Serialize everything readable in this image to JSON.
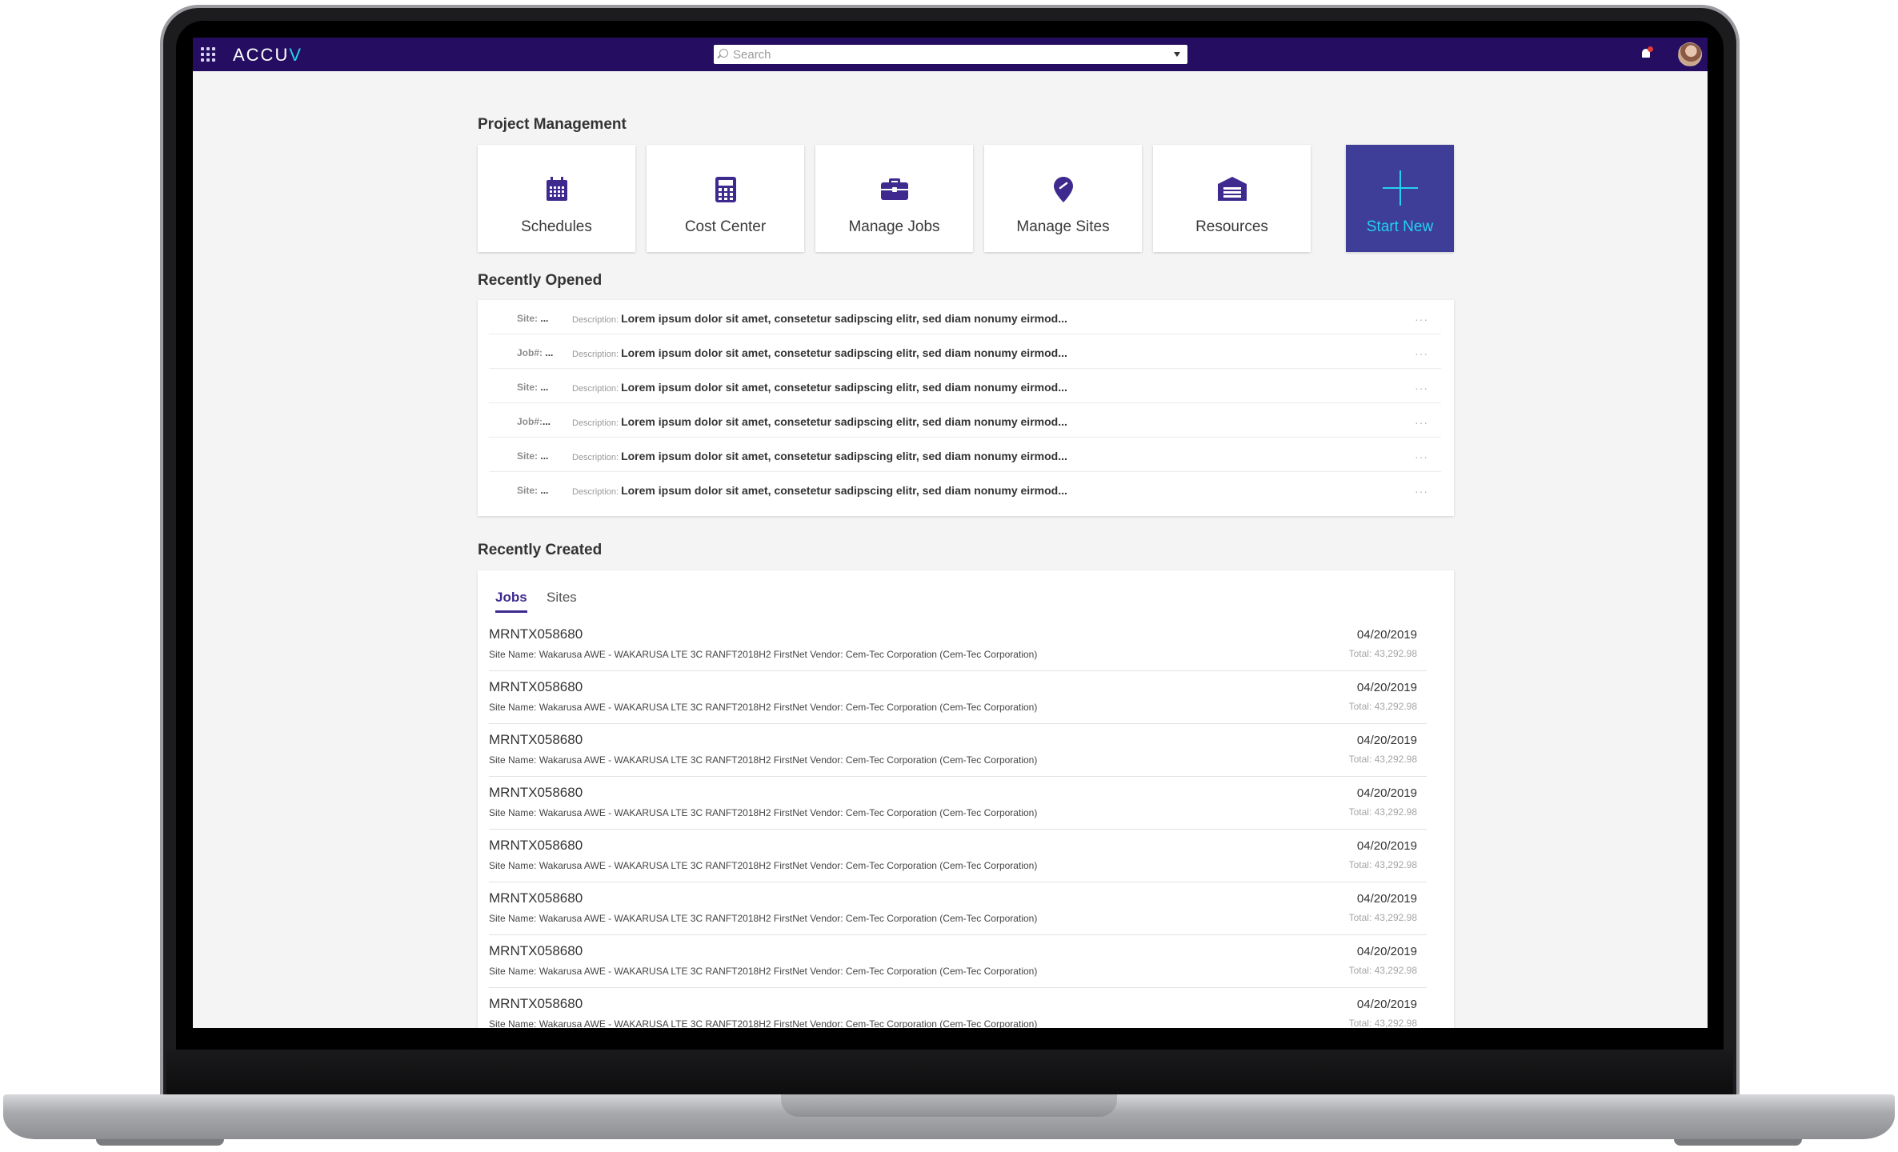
{
  "header": {
    "logo_text": "ACCU",
    "logo_accent": "V",
    "search_placeholder": "Search"
  },
  "project_management": {
    "title": "Project Management",
    "tiles": [
      {
        "label": "Schedules",
        "icon": "calendar-icon"
      },
      {
        "label": "Cost Center",
        "icon": "calculator-icon"
      },
      {
        "label": "Manage Jobs",
        "icon": "briefcase-icon"
      },
      {
        "label": "Manage Sites",
        "icon": "location-pin-icon"
      },
      {
        "label": "Resources",
        "icon": "warehouse-icon"
      },
      {
        "label": "Start New",
        "icon": "plus-icon"
      }
    ]
  },
  "recently_opened": {
    "title": "Recently Opened",
    "description_label": "Description:",
    "items": [
      {
        "key": "Site:",
        "value": "...",
        "description": "Lorem ipsum dolor sit amet, consetetur sadipscing elitr, sed diam nonumy eirmod..."
      },
      {
        "key": "Job#:",
        "value": "...",
        "description": "Lorem ipsum dolor sit amet, consetetur sadipscing elitr, sed diam nonumy eirmod..."
      },
      {
        "key": "Site:",
        "value": "...",
        "description": "Lorem ipsum dolor sit amet, consetetur sadipscing elitr, sed diam nonumy eirmod..."
      },
      {
        "key": "Job#:",
        "value": "...",
        "description": "Lorem ipsum dolor sit amet, consetetur sadipscing elitr, sed diam nonumy eirmod..."
      },
      {
        "key": "Site:",
        "value": "...",
        "description": "Lorem ipsum dolor sit amet, consetetur sadipscing elitr, sed diam nonumy eirmod..."
      },
      {
        "key": "Site:",
        "value": "...",
        "description": "Lorem ipsum dolor sit amet, consetetur sadipscing elitr, sed diam nonumy eirmod..."
      }
    ],
    "more_label": "···"
  },
  "recently_created": {
    "title": "Recently Created",
    "tabs": [
      {
        "label": "Jobs",
        "active": true
      },
      {
        "label": "Sites",
        "active": false
      }
    ],
    "rows": [
      {
        "id": "MRNTX058680",
        "site": "Site Name: Wakarusa AWE - WAKARUSA LTE 3C RANFT2018H2 FirstNet Vendor: Cem-Tec Corporation (Cem-Tec Corporation)",
        "date": "04/20/2019",
        "total": "Total: 43,292.98"
      },
      {
        "id": "MRNTX058680",
        "site": "Site Name: Wakarusa AWE - WAKARUSA LTE 3C RANFT2018H2 FirstNet Vendor: Cem-Tec Corporation (Cem-Tec Corporation)",
        "date": "04/20/2019",
        "total": "Total: 43,292.98"
      },
      {
        "id": "MRNTX058680",
        "site": "Site Name: Wakarusa AWE - WAKARUSA LTE 3C RANFT2018H2 FirstNet Vendor: Cem-Tec Corporation (Cem-Tec Corporation)",
        "date": "04/20/2019",
        "total": "Total: 43,292.98"
      },
      {
        "id": "MRNTX058680",
        "site": "Site Name: Wakarusa AWE - WAKARUSA LTE 3C RANFT2018H2 FirstNet Vendor: Cem-Tec Corporation (Cem-Tec Corporation)",
        "date": "04/20/2019",
        "total": "Total: 43,292.98"
      },
      {
        "id": "MRNTX058680",
        "site": "Site Name: Wakarusa AWE - WAKARUSA LTE 3C RANFT2018H2 FirstNet Vendor: Cem-Tec Corporation (Cem-Tec Corporation)",
        "date": "04/20/2019",
        "total": "Total: 43,292.98"
      },
      {
        "id": "MRNTX058680",
        "site": "Site Name: Wakarusa AWE - WAKARUSA LTE 3C RANFT2018H2 FirstNet Vendor: Cem-Tec Corporation (Cem-Tec Corporation)",
        "date": "04/20/2019",
        "total": "Total: 43,292.98"
      },
      {
        "id": "MRNTX058680",
        "site": "Site Name: Wakarusa AWE - WAKARUSA LTE 3C RANFT2018H2 FirstNet Vendor: Cem-Tec Corporation (Cem-Tec Corporation)",
        "date": "04/20/2019",
        "total": "Total: 43,292.98"
      },
      {
        "id": "MRNTX058680",
        "site": "Site Name: Wakarusa AWE - WAKARUSA LTE 3C RANFT2018H2 FirstNet Vendor: Cem-Tec Corporation (Cem-Tec Corporation)",
        "date": "04/20/2019",
        "total": "Total: 43,292.98"
      }
    ]
  },
  "colors": {
    "topbar": "#250e62",
    "accent": "#22d3ee",
    "start_tile": "#3e3d97",
    "tile_icon": "#3e2a8f",
    "notification": "#e53935"
  }
}
